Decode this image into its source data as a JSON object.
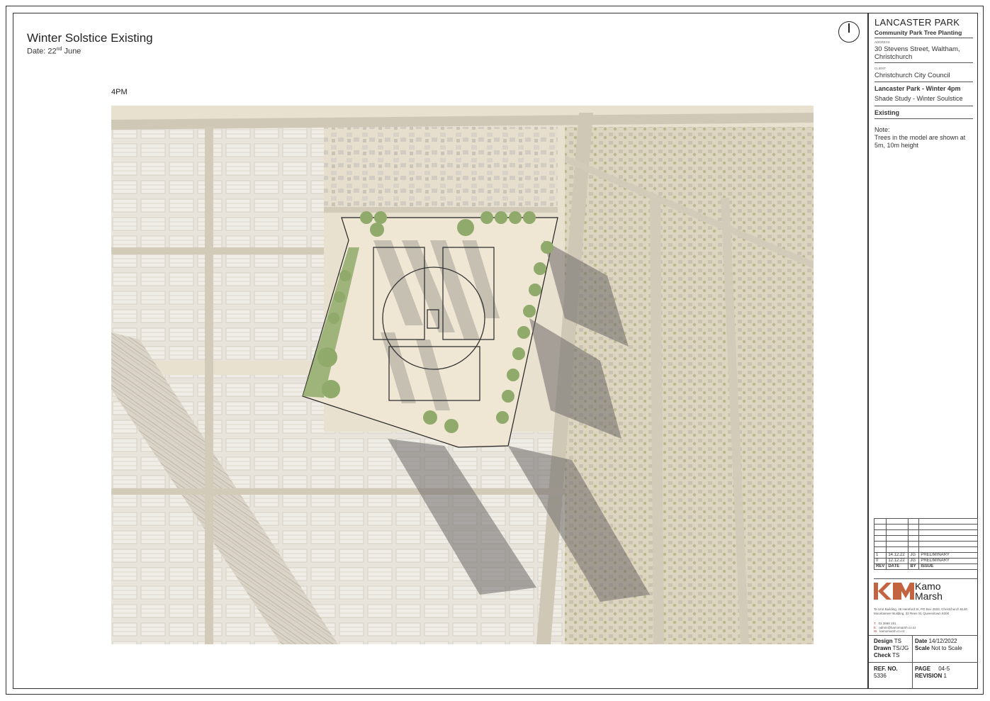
{
  "sheet": {
    "title": "Winter Solstice  Existing",
    "date_prefix": "Date: 22",
    "date_sup": "nd",
    "date_suffix": " June",
    "time_label": "4PM"
  },
  "title_block": {
    "project": "LANCASTER PARK",
    "subtitle": "Community Park Tree Planting",
    "address_caption": "ADDRESS",
    "address": "30 Stevens Street, Waltham, Christchurch",
    "client_caption": "CLIENT",
    "client": "Christchurch City Council",
    "drawing_title": "Lancaster Park - Winter 4pm",
    "drawing_subtitle": "Shade Study - Winter Soulstice",
    "status": "Existing",
    "note_heading": "Note:",
    "note_text": "Trees in the model are shown at 5m, 10m height"
  },
  "revisions": {
    "headers": [
      "REV",
      "DATE",
      "BY",
      "ISSUE"
    ],
    "rows": [
      [
        "1",
        "14.12.22",
        "JG",
        "PRELIMINARY"
      ],
      [
        "0",
        "12.12.22",
        "JG",
        "PRELIMINARY"
      ]
    ]
  },
  "company": {
    "name_line1": "Kamo",
    "name_line2": "Marsh",
    "brand_color": "#c4633f",
    "address": "Te Urut Building, 48 Hereford St, PO Box 2833, Christchurch 8140 Mountaineer Building, 32 Rees St, Queenstown 9300",
    "phone_label": "T.",
    "phone": "03 3668 191",
    "email_label": "E.",
    "email": "admin@kamomarsh.co.nz",
    "web_label": "W.",
    "web": "kamomarsh.co.nz"
  },
  "details": {
    "design_label": "Design",
    "design": "TS",
    "drawn_label": "Drawn",
    "drawn": "TS/JG",
    "check_label": "Check",
    "check": "TS",
    "date_label": "Date",
    "date": "14/12/2022",
    "scale_label": "Scale",
    "scale": "Not to Scale",
    "ref_label": "REF. NO.",
    "ref": "5336",
    "page_label": "PAGE",
    "page": "04-5",
    "revision_label": "REVISION",
    "revision": "1"
  },
  "colors": {
    "map_base": "#e9e1cf",
    "road": "#cfc8b6",
    "park_field": "#efe6d4",
    "shadow": "#7d7a78",
    "tree": "#8faa6a",
    "roof": "#dcd8cf"
  },
  "icons": {
    "north_arrow": "north-arrow-icon"
  }
}
